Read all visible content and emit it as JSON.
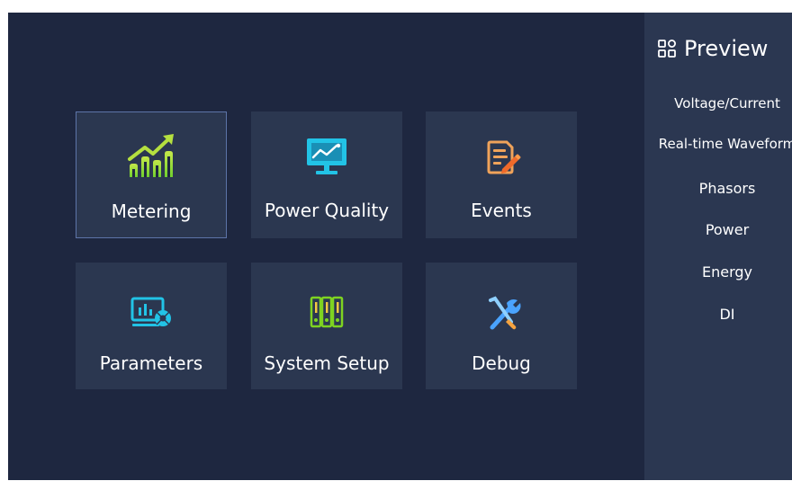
{
  "tiles": {
    "metering": {
      "label": "Metering",
      "icon": "bar-chart-trend-icon",
      "selected": true
    },
    "power_quality": {
      "label": "Power Quality",
      "icon": "monitor-chart-icon"
    },
    "events": {
      "label": "Events",
      "icon": "document-edit-icon"
    },
    "parameters": {
      "label": "Parameters",
      "icon": "screen-settings-icon"
    },
    "system_setup": {
      "label": "System Setup",
      "icon": "binders-icon"
    },
    "debug": {
      "label": "Debug",
      "icon": "tools-icon"
    }
  },
  "sidebar": {
    "title": "Preview",
    "title_icon": "grid-apps-icon",
    "items": [
      {
        "label": "Voltage/Current"
      },
      {
        "label": "Real-time Waveform"
      },
      {
        "label": "Phasors"
      },
      {
        "label": "Power"
      },
      {
        "label": "Energy"
      },
      {
        "label": "DI"
      }
    ]
  },
  "colors": {
    "background": "#1e2740",
    "tile": "#2b3750",
    "selected_border": "#5d74a8",
    "accent_green": "#7ed321",
    "accent_cyan": "#22c3e6",
    "accent_orange": "#f29a4a",
    "accent_blue": "#4aa3ff"
  }
}
